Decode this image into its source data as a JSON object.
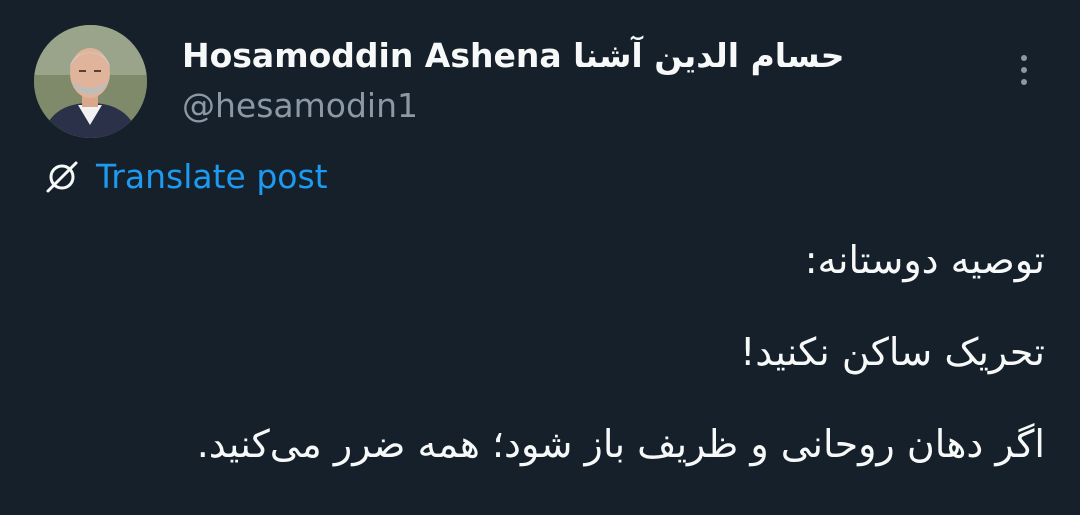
{
  "author": {
    "display_name": "Hosamoddin Ashena حسام الدین آشنا",
    "handle": "@hesamodin1"
  },
  "actions": {
    "translate_label": "Translate post"
  },
  "post": {
    "lines": [
      "توصیه دوستانه:",
      "تحریک ساکن نکنید!",
      "اگر دهان روحانی و ظریف باز شود؛ همه ضرر می‌کنید."
    ]
  },
  "icons": {
    "more": "more-vertical-icon",
    "translate": "translate-globe-icon"
  },
  "colors": {
    "background": "#15202b",
    "primary_text": "#f7f9f9",
    "secondary_text": "#8b98a5",
    "link": "#1d9bf0"
  }
}
